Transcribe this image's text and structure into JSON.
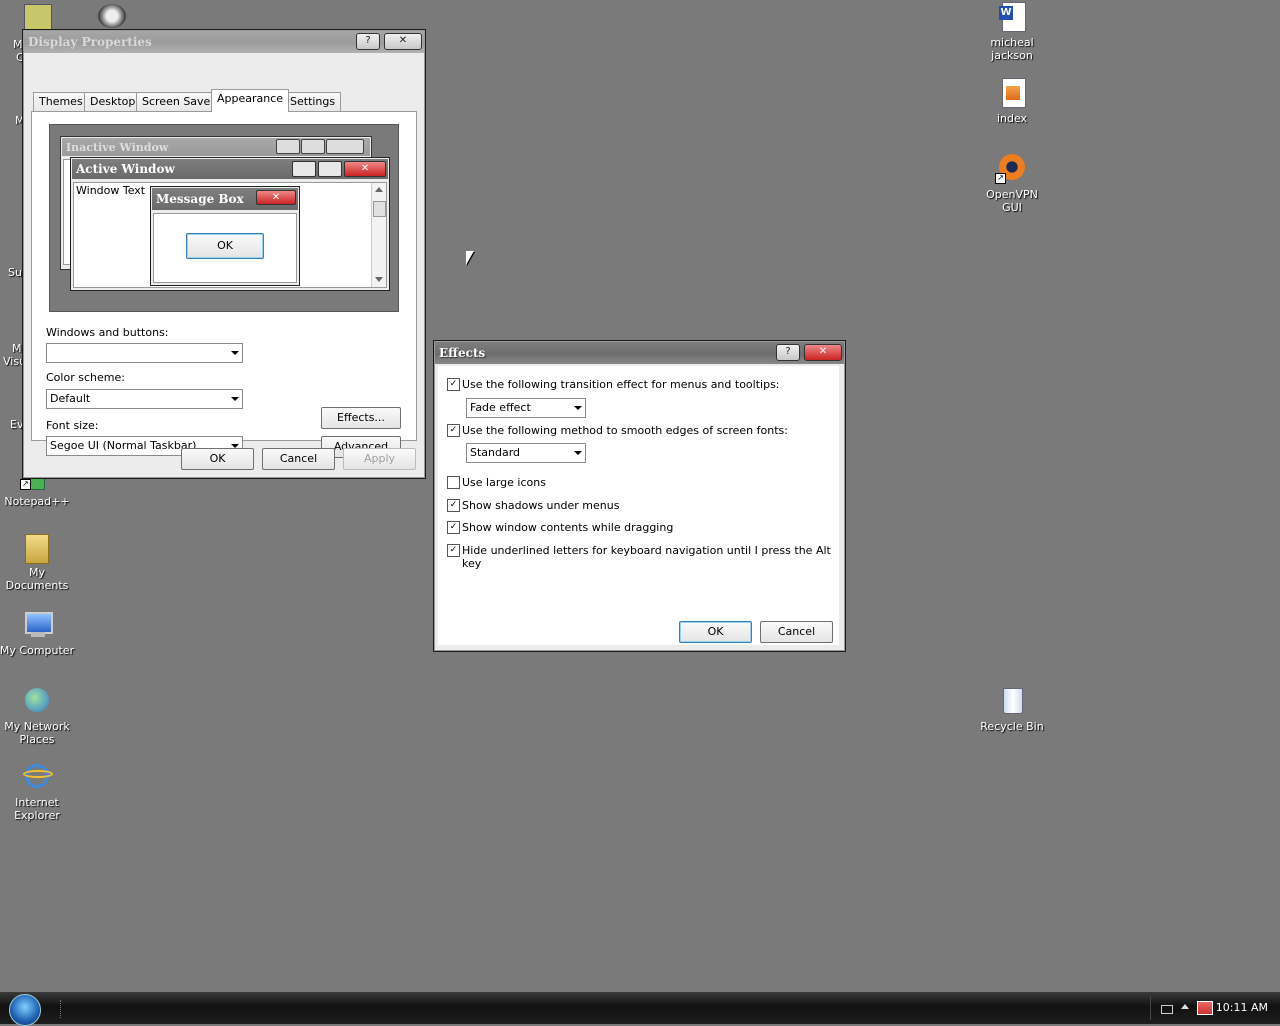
{
  "desktop": {
    "left_icons": [
      {
        "label": "Notepad++",
        "icon": "notepad-plus-plus-icon"
      },
      {
        "label": "My\nDocuments",
        "icon": "folder-icon"
      },
      {
        "label": "My Computer",
        "icon": "computer-icon"
      },
      {
        "label": "My Network\nPlaces",
        "icon": "network-icon"
      },
      {
        "label": "Internet\nExplorer",
        "icon": "internet-explorer-icon"
      }
    ],
    "partial_left_labels": [
      "M",
      "C",
      "M",
      "Su",
      "M",
      "Visu",
      "Ev"
    ],
    "right_icons": [
      {
        "label": "micheal\njackson",
        "icon": "word-document-icon"
      },
      {
        "label": "index",
        "icon": "html-file-icon"
      },
      {
        "label": "OpenVPN\nGUI",
        "icon": "openvpn-icon"
      },
      {
        "label": "Recycle Bin",
        "icon": "recycle-bin-icon"
      }
    ]
  },
  "display_properties": {
    "title": "Display Properties",
    "help_glyph": "?",
    "close_glyph": "✕",
    "tabs": [
      "Themes",
      "Desktop",
      "Screen Saver",
      "Appearance",
      "Settings"
    ],
    "active_tab": "Appearance",
    "preview": {
      "inactive_title": "Inactive Window",
      "active_title": "Active Window",
      "window_text": "Window Text",
      "message_box_title": "Message Box",
      "message_box_ok": "OK"
    },
    "windows_buttons_label": "Windows and buttons:",
    "windows_buttons_value": "",
    "color_scheme_label": "Color scheme:",
    "color_scheme_value": "Default",
    "font_size_label": "Font size:",
    "font_size_value": "Segoe UI (Normal Taskbar)",
    "effects_button": "Effects...",
    "advanced_button": "Advanced",
    "ok": "OK",
    "cancel": "Cancel",
    "apply": "Apply"
  },
  "effects": {
    "title": "Effects",
    "help_glyph": "?",
    "close_glyph": "✕",
    "options": [
      {
        "label": "Use the following transition effect for menus and tooltips:",
        "checked": true
      },
      {
        "label": "Use the following method to smooth edges of screen fonts:",
        "checked": true
      },
      {
        "label": "Use large icons",
        "checked": false
      },
      {
        "label": "Show shadows under menus",
        "checked": true
      },
      {
        "label": "Show window contents while dragging",
        "checked": true
      },
      {
        "label": "Hide underlined letters for keyboard navigation until I press the Alt key",
        "checked": true
      }
    ],
    "transition_value": "Fade effect",
    "smoothing_value": "Standard",
    "ok": "OK",
    "cancel": "Cancel"
  },
  "taskbar": {
    "clock": "10:11 AM"
  },
  "colors": {
    "desktop": "#7a7a7a",
    "title_active": "#6d6d6d",
    "close_button": "#c22222"
  }
}
